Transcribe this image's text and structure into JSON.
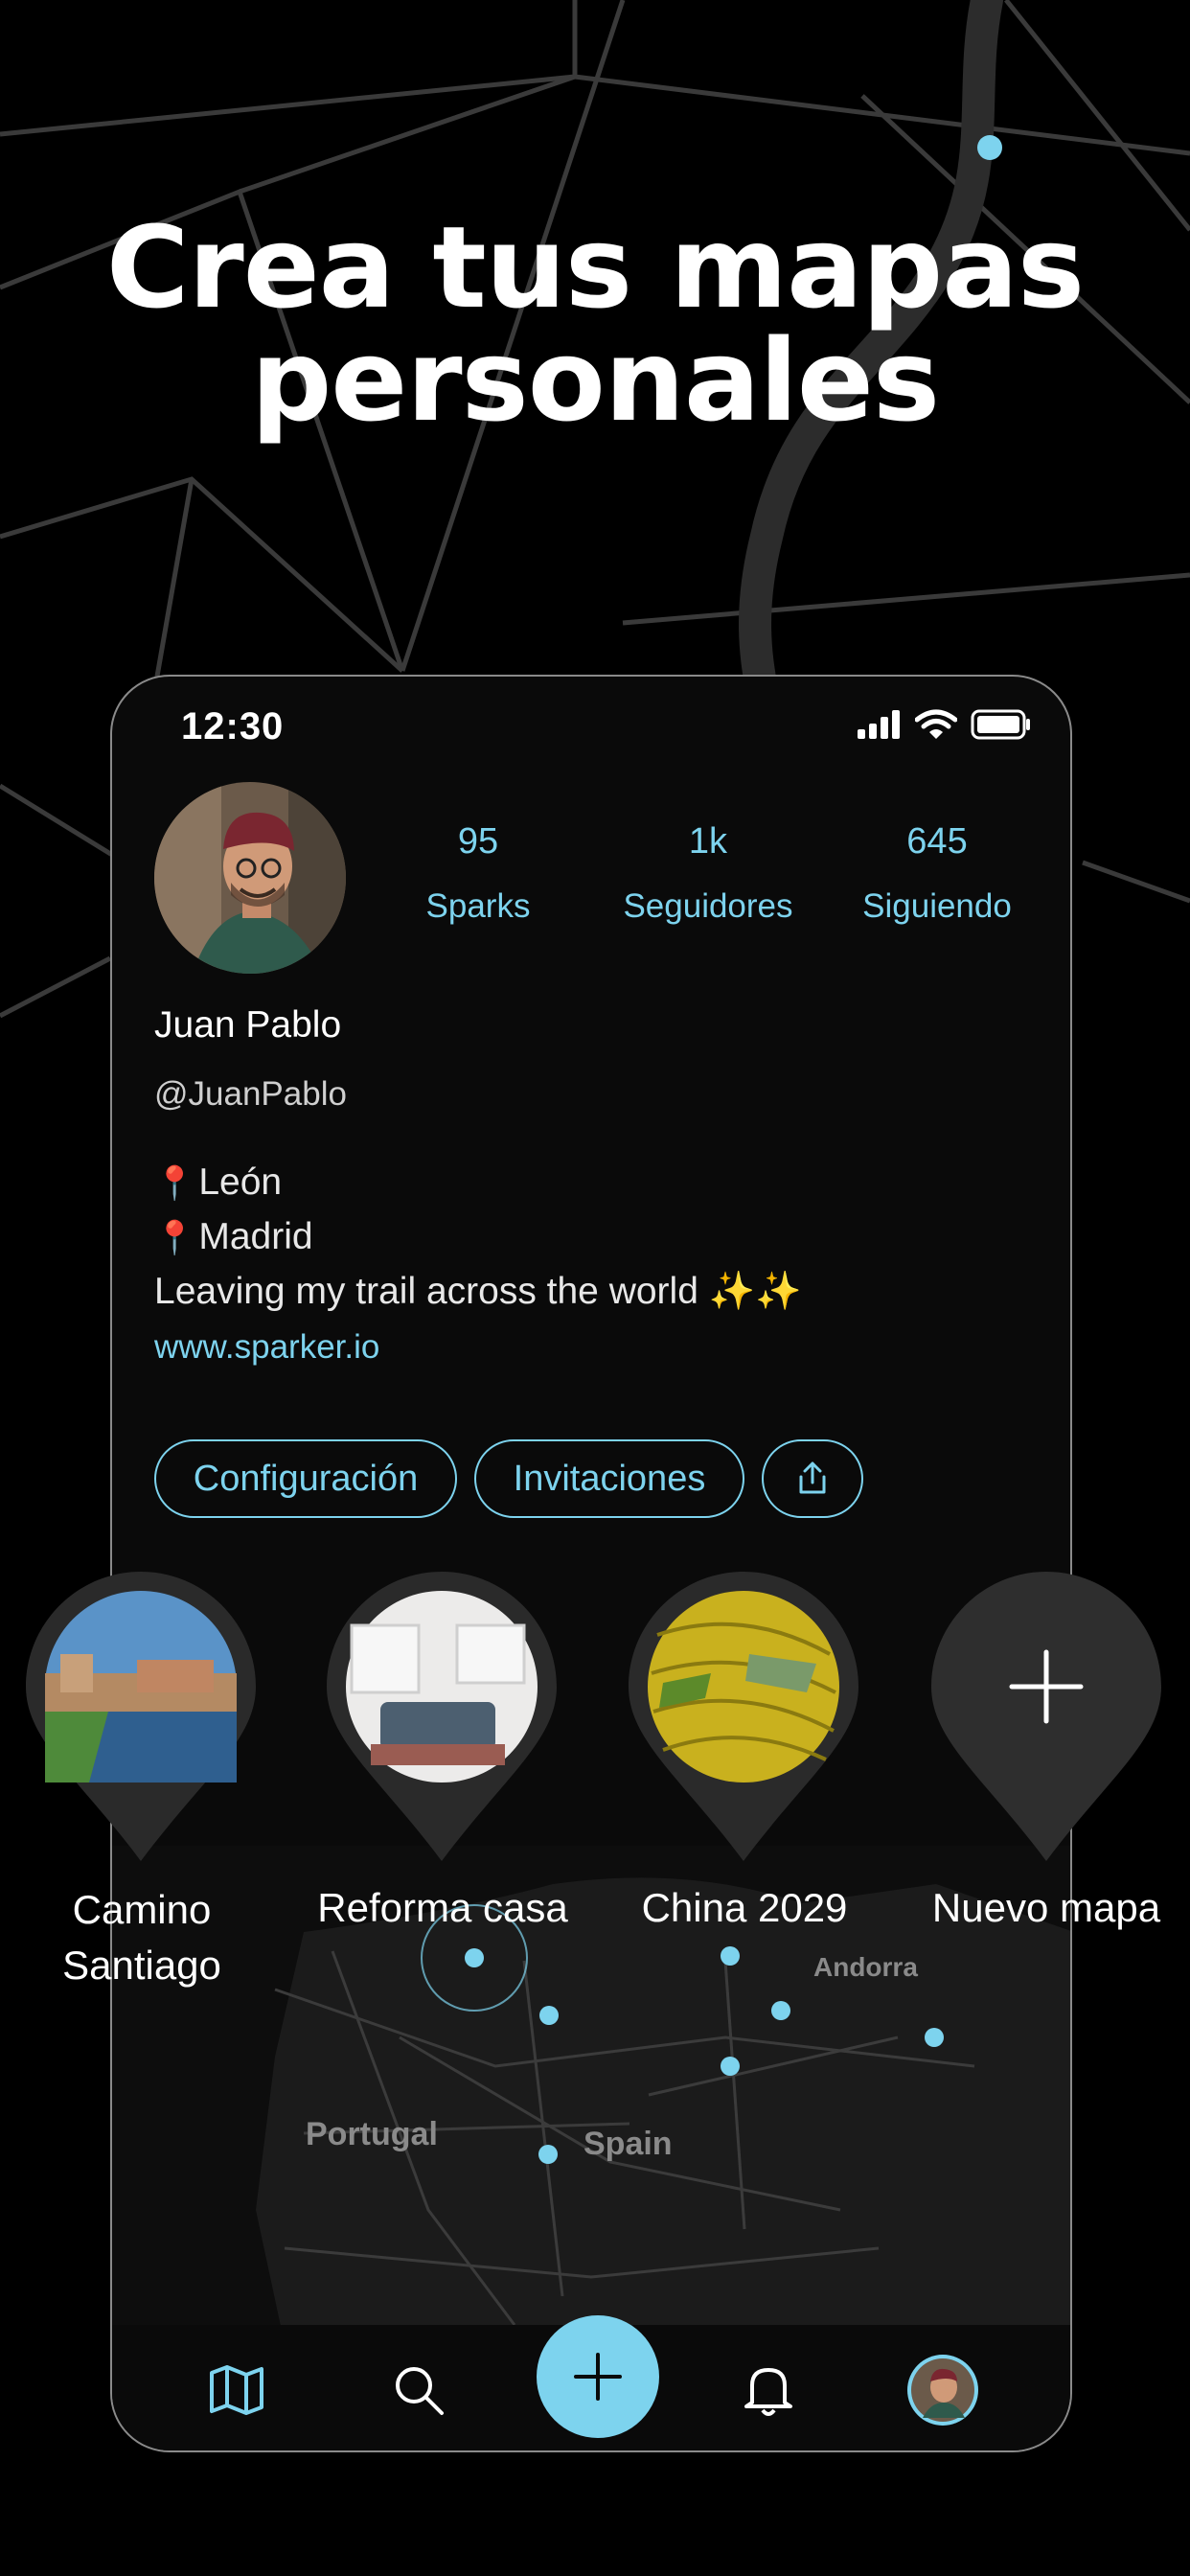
{
  "headline": {
    "line1": "Crea tus mapas",
    "line2": "personales"
  },
  "status_bar": {
    "time": "12:30"
  },
  "profile": {
    "name": "Juan Pablo",
    "handle": "@JuanPablo",
    "bio_line1": "León",
    "bio_line2": "Madrid",
    "bio_line3": "Leaving my trail across the world ✨✨",
    "website": "www.sparker.io",
    "stats": [
      {
        "value": "95",
        "label": "Sparks"
      },
      {
        "value": "1k",
        "label": "Seguidores"
      },
      {
        "value": "645",
        "label": "Siguiendo"
      }
    ]
  },
  "actions": {
    "settings": "Configuración",
    "invitations": "Invitaciones"
  },
  "maps": [
    {
      "line1": "Camino",
      "line2": "Santiago"
    },
    {
      "line1": "Reforma casa",
      "line2": ""
    },
    {
      "line1": "China 2029",
      "line2": ""
    },
    {
      "line1": "Nuevo mapa",
      "line2": ""
    }
  ],
  "map_labels": {
    "andorra": "Andorra",
    "portugal": "Portugal",
    "spain": "Spain"
  },
  "colors": {
    "accent": "#7dd3ee",
    "background": "#000000",
    "pin": "#2a2a2a"
  },
  "icons": {
    "tabs": [
      "map-icon",
      "search-icon",
      "plus-icon",
      "bell-icon",
      "avatar"
    ]
  }
}
